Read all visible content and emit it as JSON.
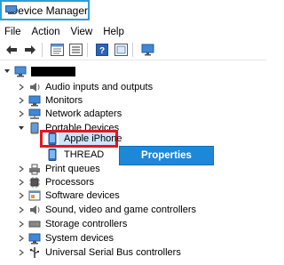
{
  "window": {
    "title": "Device Manager"
  },
  "menu": {
    "items": [
      "File",
      "Action",
      "View",
      "Help"
    ]
  },
  "toolbar": {
    "buttons": [
      "back-icon",
      "forward-icon",
      "properties-icon",
      "help-icon",
      "scan-icon",
      "monitor-icon"
    ]
  },
  "tree": {
    "root_label": "",
    "nodes": [
      {
        "label": "Audio inputs and outputs",
        "icon": "speaker-icon",
        "expanded": false
      },
      {
        "label": "Monitors",
        "icon": "monitor-icon",
        "expanded": false
      },
      {
        "label": "Network adapters",
        "icon": "network-icon",
        "expanded": false
      },
      {
        "label": "Portable Devices",
        "icon": "portable-device-icon",
        "expanded": true
      },
      {
        "label": "Apple iPhone",
        "icon": "phone-icon",
        "child": true,
        "selected": true
      },
      {
        "label": "THREAD",
        "icon": "phone-icon",
        "child": true
      },
      {
        "label": "Print queues",
        "icon": "printer-icon",
        "expanded": false
      },
      {
        "label": "Processors",
        "icon": "processor-icon",
        "expanded": false
      },
      {
        "label": "Software devices",
        "icon": "software-icon",
        "expanded": false
      },
      {
        "label": "Sound, video and game controllers",
        "icon": "speaker-icon",
        "expanded": false
      },
      {
        "label": "Storage controllers",
        "icon": "storage-icon",
        "expanded": false
      },
      {
        "label": "System devices",
        "icon": "system-icon",
        "expanded": false
      },
      {
        "label": "Universal Serial Bus controllers",
        "icon": "usb-icon",
        "expanded": false
      }
    ]
  },
  "context_menu": {
    "items": [
      "Properties"
    ]
  },
  "colors": {
    "accent": "#1e88d8",
    "highlight_box": "#e3171d",
    "title_border": "#2a9fd8",
    "selection": "#cfe5fb"
  }
}
